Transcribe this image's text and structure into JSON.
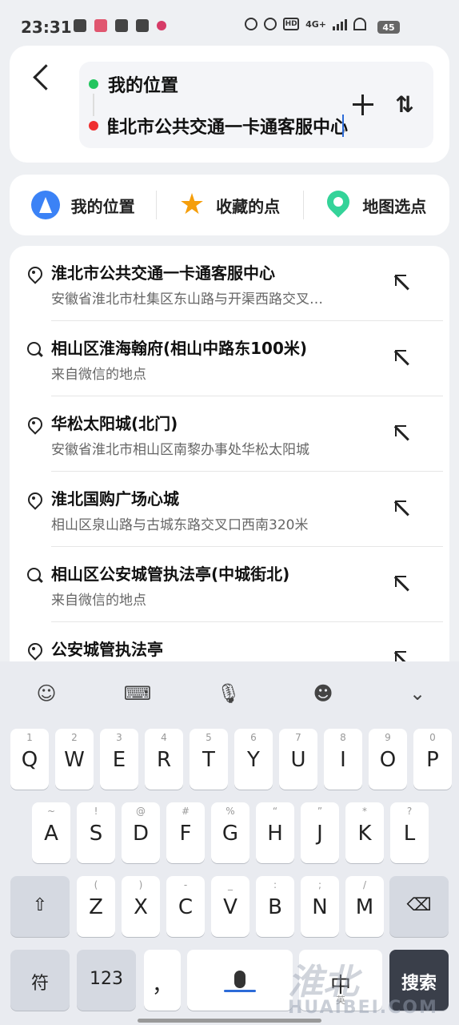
{
  "status_bar": {
    "time": "23:31",
    "network": "4G+",
    "battery": "45"
  },
  "route": {
    "from": "我的位置",
    "to": "淮北市公共交通一卡通客服中心"
  },
  "quick_options": [
    {
      "label": "我的位置",
      "icon": "my-location-icon"
    },
    {
      "label": "收藏的点",
      "icon": "star-icon"
    },
    {
      "label": "地图选点",
      "icon": "map-pin-icon"
    }
  ],
  "results": [
    {
      "title": "淮北市公共交通一卡通客服中心",
      "subtitle": "安徽省淮北市杜集区东山路与开渠西路交叉…",
      "icon": "place-icon"
    },
    {
      "title": "相山区淮海翰府(相山中路东100米)",
      "subtitle": "来自微信的地点",
      "icon": "search-icon"
    },
    {
      "title": "华松太阳城(北门)",
      "subtitle": "安徽省淮北市相山区南黎办事处华松太阳城",
      "icon": "place-icon"
    },
    {
      "title": "淮北国购广场心城",
      "subtitle": "相山区泉山路与古城东路交叉口西南320米",
      "icon": "place-icon"
    },
    {
      "title": "相山区公安城管执法亭(中城街北)",
      "subtitle": "来自微信的地点",
      "icon": "search-icon"
    },
    {
      "title": "公安城管执法亭",
      "subtitle": "",
      "icon": "place-icon"
    }
  ],
  "keyboard": {
    "row1": [
      [
        "1",
        "Q"
      ],
      [
        "2",
        "W"
      ],
      [
        "3",
        "E"
      ],
      [
        "4",
        "R"
      ],
      [
        "5",
        "T"
      ],
      [
        "6",
        "Y"
      ],
      [
        "7",
        "U"
      ],
      [
        "8",
        "I"
      ],
      [
        "9",
        "O"
      ],
      [
        "0",
        "P"
      ]
    ],
    "row2": [
      [
        "~",
        "A"
      ],
      [
        "!",
        "S"
      ],
      [
        "@",
        "D"
      ],
      [
        "#",
        "F"
      ],
      [
        "%",
        "G"
      ],
      [
        "“",
        "H"
      ],
      [
        "”",
        "J"
      ],
      [
        "*",
        "K"
      ],
      [
        "?",
        "L"
      ]
    ],
    "row3": [
      [
        "(",
        "Z"
      ],
      [
        ")",
        "X"
      ],
      [
        "-",
        "C"
      ],
      [
        "_",
        "V"
      ],
      [
        ":",
        "B"
      ],
      [
        ";",
        "N"
      ],
      [
        "/",
        "M"
      ]
    ],
    "symbols_label": "符",
    "numbers_label": "123",
    "comma_label": "，",
    "lang_label": "中",
    "lang_sub": "英",
    "search_label": "搜索"
  },
  "watermark": {
    "main": "淮北",
    "sub": "HUAIBEI.COM"
  }
}
